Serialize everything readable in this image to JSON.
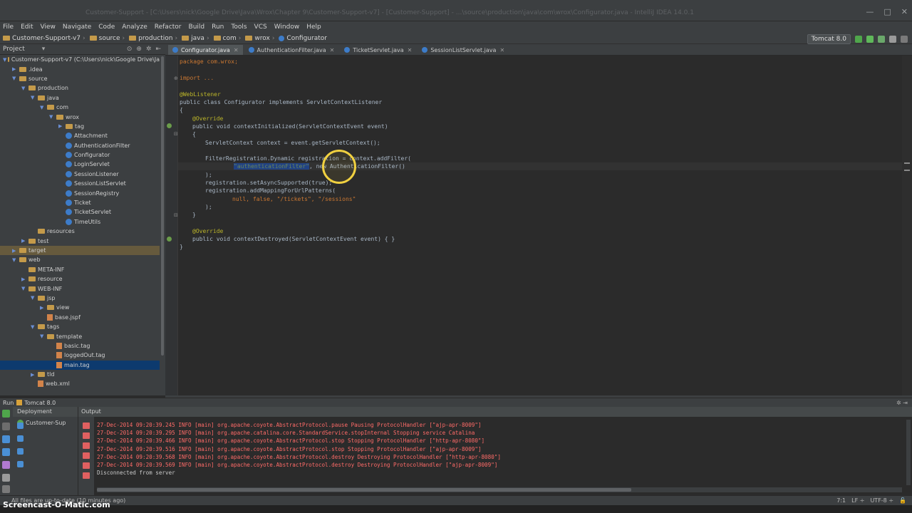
{
  "window": {
    "title": "Customer-Support - [C:\\Users\\nick\\Google Drive\\Java\\Wrox\\Chapter 9\\Customer-Support-v7] - [Customer-Support] - ...\\source\\production\\java\\com\\wrox\\Configurator.java - IntelliJ IDEA 14.0.1"
  },
  "menu": [
    "File",
    "Edit",
    "View",
    "Navigate",
    "Code",
    "Analyze",
    "Refactor",
    "Build",
    "Run",
    "Tools",
    "VCS",
    "Window",
    "Help"
  ],
  "breadcrumbs": [
    "Customer-Support-v7",
    "source",
    "production",
    "java",
    "com",
    "wrox",
    "Configurator"
  ],
  "run_config": {
    "label": "Tomcat 8.0"
  },
  "project_panel": {
    "title": "Project"
  },
  "project_tree": [
    {
      "label": "Customer-Support-v7 (C:\\Users\\nick\\Google Drive\\Ja",
      "indent": 0,
      "type": "folder",
      "open": true
    },
    {
      "label": ".idea",
      "indent": 1,
      "type": "folder",
      "open": false
    },
    {
      "label": "source",
      "indent": 1,
      "type": "folder",
      "open": true
    },
    {
      "label": "production",
      "indent": 2,
      "type": "folder",
      "open": true
    },
    {
      "label": "java",
      "indent": 3,
      "type": "folder",
      "open": true
    },
    {
      "label": "com",
      "indent": 4,
      "type": "folder",
      "open": true
    },
    {
      "label": "wrox",
      "indent": 5,
      "type": "folder",
      "open": true
    },
    {
      "label": "tag",
      "indent": 6,
      "type": "folder",
      "open": false
    },
    {
      "label": "Attachment",
      "indent": 6,
      "type": "class"
    },
    {
      "label": "AuthenticationFilter",
      "indent": 6,
      "type": "class"
    },
    {
      "label": "Configurator",
      "indent": 6,
      "type": "class"
    },
    {
      "label": "LoginServlet",
      "indent": 6,
      "type": "class"
    },
    {
      "label": "SessionListener",
      "indent": 6,
      "type": "class"
    },
    {
      "label": "SessionListServlet",
      "indent": 6,
      "type": "class"
    },
    {
      "label": "SessionRegistry",
      "indent": 6,
      "type": "class"
    },
    {
      "label": "Ticket",
      "indent": 6,
      "type": "class"
    },
    {
      "label": "TicketServlet",
      "indent": 6,
      "type": "class"
    },
    {
      "label": "TimeUtils",
      "indent": 6,
      "type": "class"
    },
    {
      "label": "resources",
      "indent": 3,
      "type": "folder"
    },
    {
      "label": "test",
      "indent": 2,
      "type": "folder",
      "open": false
    },
    {
      "label": "target",
      "indent": 1,
      "type": "folder",
      "open": false,
      "excluded": true
    },
    {
      "label": "web",
      "indent": 1,
      "type": "folder",
      "open": true
    },
    {
      "label": "META-INF",
      "indent": 2,
      "type": "folder"
    },
    {
      "label": "resource",
      "indent": 2,
      "type": "folder",
      "open": false
    },
    {
      "label": "WEB-INF",
      "indent": 2,
      "type": "folder",
      "open": true
    },
    {
      "label": "jsp",
      "indent": 3,
      "type": "folder",
      "open": true
    },
    {
      "label": "view",
      "indent": 4,
      "type": "folder",
      "open": false
    },
    {
      "label": "base.jspf",
      "indent": 4,
      "type": "file"
    },
    {
      "label": "tags",
      "indent": 3,
      "type": "folder",
      "open": true
    },
    {
      "label": "template",
      "indent": 4,
      "type": "folder",
      "open": true
    },
    {
      "label": "basic.tag",
      "indent": 5,
      "type": "file"
    },
    {
      "label": "loggedOut.tag",
      "indent": 5,
      "type": "file"
    },
    {
      "label": "main.tag",
      "indent": 5,
      "type": "file",
      "selected": true
    },
    {
      "label": "tld",
      "indent": 3,
      "type": "folder",
      "open": false
    },
    {
      "label": "web.xml",
      "indent": 3,
      "type": "file"
    }
  ],
  "tabs": [
    {
      "label": "Configurator.java",
      "active": true
    },
    {
      "label": "AuthenticationFilter.java",
      "active": false
    },
    {
      "label": "TicketServlet.java",
      "active": false
    },
    {
      "label": "SessionListServlet.java",
      "active": false
    }
  ],
  "code": {
    "package": "package com.wrox;",
    "import": "import ...",
    "annotation1": "@WebListener",
    "class_decl": "public class Configurator implements ServletContextListener",
    "open_brace": "{",
    "override1": "@Override",
    "method1": "public void contextInitialized(ServletContextEvent event)",
    "brace_indent_open": "{",
    "context_line": "ServletContext context = event.getServletContext();",
    "filter_line": "FilterRegistration.Dynamic registration = context.addFilter(",
    "filter_name": "\"authenticationFilter\"",
    "filter_rest": ", new AuthenticationFilter()",
    "close_paren": ");",
    "async_line": "registration.setAsyncSupported(true);",
    "mapping_line": "registration.addMappingForUrlPatterns(",
    "mapping_args": "null, false, \"/tickets\", \"/sessions\"",
    "close_paren2": ");",
    "brace_indent_close": "}",
    "override2": "@Override",
    "method2": "public void contextDestroyed(ServletContextEvent event) { }",
    "close_brace": "}"
  },
  "run_panel": {
    "header": "Run",
    "config": "Tomcat 8.0",
    "deployment_title": "Deployment",
    "deployment_item": "Customer-Sup",
    "output_title": "Output"
  },
  "log": [
    {
      "text": "27-Dec-2014 09:20:39.245 INFO [main] org.apache.coyote.AbstractProtocol.pause Pausing ProtocolHandler [\"ajp-apr-8009\"]",
      "error": true
    },
    {
      "text": "27-Dec-2014 09:20:39.295 INFO [main] org.apache.catalina.core.StandardService.stopInternal Stopping service Catalina",
      "error": true
    },
    {
      "text": "27-Dec-2014 09:20:39.466 INFO [main] org.apache.coyote.AbstractProtocol.stop Stopping ProtocolHandler [\"http-apr-8080\"]",
      "error": true
    },
    {
      "text": "27-Dec-2014 09:20:39.516 INFO [main] org.apache.coyote.AbstractProtocol.stop Stopping ProtocolHandler [\"ajp-apr-8009\"]",
      "error": true
    },
    {
      "text": "27-Dec-2014 09:20:39.568 INFO [main] org.apache.coyote.AbstractProtocol.destroy Destroying ProtocolHandler [\"http-apr-8080\"]",
      "error": true
    },
    {
      "text": "27-Dec-2014 09:20:39.569 INFO [main] org.apache.coyote.AbstractProtocol.destroy Destroying ProtocolHandler [\"ajp-apr-8009\"]",
      "error": true
    },
    {
      "text": "Disconnected from server",
      "error": false
    }
  ],
  "status": {
    "message": "All files are up-to-date (10 minutes ago)",
    "position": "7:1",
    "line_sep": "LF ÷",
    "encoding": "UTF-8 ÷"
  },
  "watermark": "Screencast-O-Matic.com",
  "colors": {
    "accent_selection": "#0d3a6e",
    "log_error": "#ff6b68",
    "cursor_highlight": "#f0d040"
  }
}
